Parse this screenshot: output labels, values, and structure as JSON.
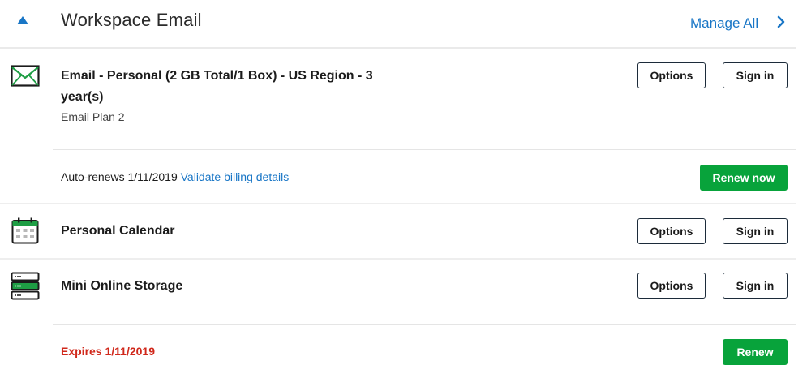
{
  "header": {
    "title": "Workspace Email",
    "manage_all": "Manage All"
  },
  "products": [
    {
      "title_line1": "Email - Personal (2 GB Total/1 Box) - US Region - 3",
      "title_line2": "year(s)",
      "subtitle": "Email Plan 2",
      "options_label": "Options",
      "signin_label": "Sign in",
      "renew_status": "Auto-renews 1/11/2019",
      "billing_link": "Validate billing details",
      "renew_label": "Renew now"
    },
    {
      "title": "Personal Calendar",
      "options_label": "Options",
      "signin_label": "Sign in"
    },
    {
      "title": "Mini Online Storage",
      "options_label": "Options",
      "signin_label": "Sign in",
      "expires": "Expires 1/11/2019",
      "renew_label": "Renew"
    }
  ],
  "icons": {
    "collapse": "triangle-up-icon",
    "manage_chevron": "chevron-right-icon",
    "email": "envelope-icon",
    "calendar": "calendar-icon",
    "storage": "server-icon"
  },
  "colors": {
    "accent_blue": "#1976c6",
    "green": "#08a33b",
    "expire_red": "#d0281b",
    "icon_green": "#1e9e44"
  }
}
